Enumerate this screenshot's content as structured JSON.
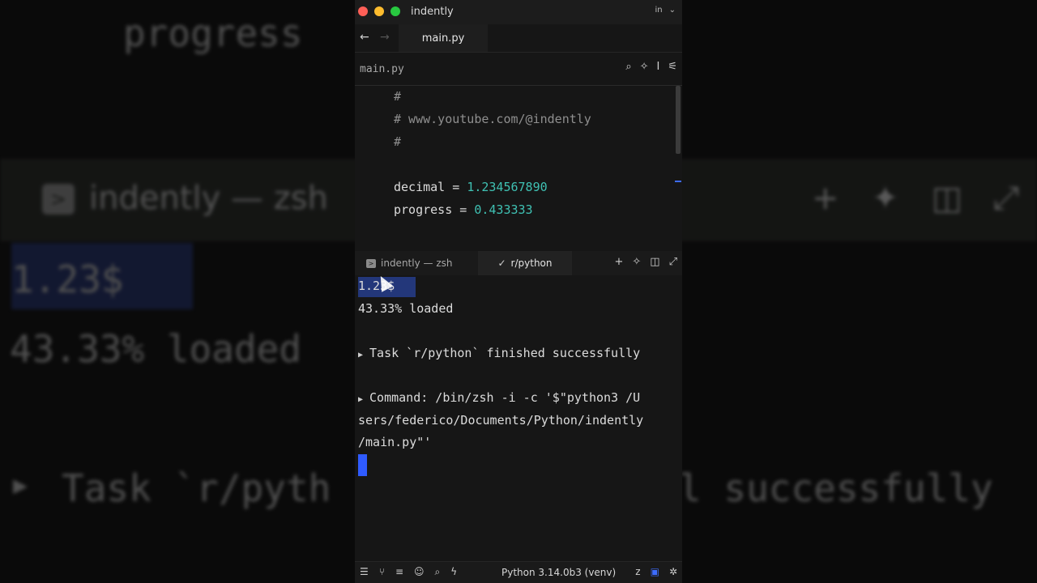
{
  "window": {
    "title": "indently",
    "account_badge": "in"
  },
  "tabs": {
    "active_file": "main.py"
  },
  "breadcrumb": "main.py",
  "editor": {
    "lines": [
      "#",
      "# www.youtube.com/@indently",
      "#",
      "",
      "decimal = ",
      "progress = "
    ],
    "decimal_value": "1.234567890",
    "progress_value": "0.433333"
  },
  "terminal_tabs": [
    {
      "label": "indently — zsh"
    },
    {
      "label": "r/python"
    }
  ],
  "terminal": {
    "line1": "1.23$",
    "line2": "43.33% loaded",
    "line3": "Task `r/python` finished successfully",
    "line4": "Command: /bin/zsh -i -c '$\"python3 /U",
    "line5": "sers/federico/Documents/Python/indently",
    "line6": "/main.py\"'"
  },
  "status": {
    "interpreter": "Python 3.14.0b3 (venv)"
  },
  "background": {
    "code": "progress",
    "title": "indently — zsh",
    "line1": "1.23$",
    "line2": "43.33% loaded",
    "line3_left": "Task `r/pyth",
    "line3_right": "l successfully"
  },
  "colors": {
    "number": "#3fc1b3",
    "accent": "#3d6cff",
    "selection": "#23377a"
  }
}
